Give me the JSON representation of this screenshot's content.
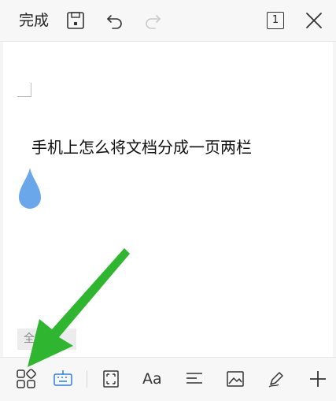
{
  "toolbar": {
    "done_label": "完成",
    "page_number": "1",
    "icons": [
      "save-icon",
      "undo-icon",
      "redo-icon",
      "page-icon",
      "close-icon"
    ]
  },
  "document": {
    "title": "手机上怎么将文档分成一页两栏",
    "fulltext_label": "全文"
  },
  "bottom_toolbar": {
    "font_label": "Aa",
    "icons": [
      "grid-icon",
      "keyboard-icon",
      "fullscreen-icon",
      "font-icon",
      "align-icon",
      "image-icon",
      "pen-icon",
      "plus-icon"
    ]
  },
  "colors": {
    "accent": "#2f7de1",
    "drop": "#6aa6ea",
    "arrow": "#2fb52f"
  }
}
